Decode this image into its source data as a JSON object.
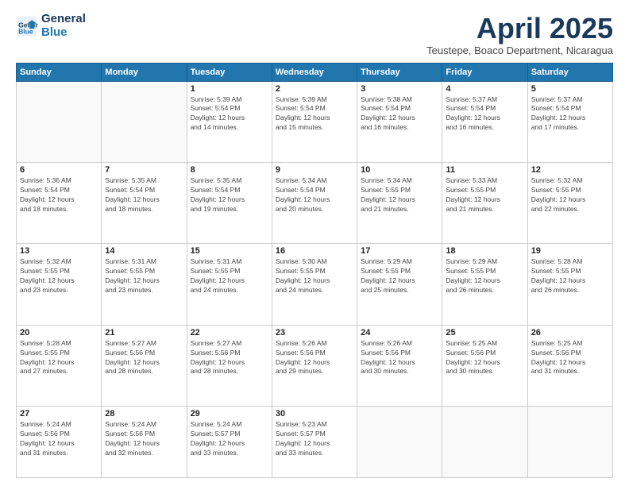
{
  "header": {
    "logo_line1": "General",
    "logo_line2": "Blue",
    "month": "April 2025",
    "location": "Teustepe, Boaco Department, Nicaragua"
  },
  "weekdays": [
    "Sunday",
    "Monday",
    "Tuesday",
    "Wednesday",
    "Thursday",
    "Friday",
    "Saturday"
  ],
  "weeks": [
    [
      {
        "day": "",
        "info": ""
      },
      {
        "day": "",
        "info": ""
      },
      {
        "day": "1",
        "info": "Sunrise: 5:39 AM\nSunset: 5:54 PM\nDaylight: 12 hours\nand 14 minutes."
      },
      {
        "day": "2",
        "info": "Sunrise: 5:39 AM\nSunset: 5:54 PM\nDaylight: 12 hours\nand 15 minutes."
      },
      {
        "day": "3",
        "info": "Sunrise: 5:38 AM\nSunset: 5:54 PM\nDaylight: 12 hours\nand 16 minutes."
      },
      {
        "day": "4",
        "info": "Sunrise: 5:37 AM\nSunset: 5:54 PM\nDaylight: 12 hours\nand 16 minutes."
      },
      {
        "day": "5",
        "info": "Sunrise: 5:37 AM\nSunset: 5:54 PM\nDaylight: 12 hours\nand 17 minutes."
      }
    ],
    [
      {
        "day": "6",
        "info": "Sunrise: 5:36 AM\nSunset: 5:54 PM\nDaylight: 12 hours\nand 18 minutes."
      },
      {
        "day": "7",
        "info": "Sunrise: 5:35 AM\nSunset: 5:54 PM\nDaylight: 12 hours\nand 18 minutes."
      },
      {
        "day": "8",
        "info": "Sunrise: 5:35 AM\nSunset: 5:54 PM\nDaylight: 12 hours\nand 19 minutes."
      },
      {
        "day": "9",
        "info": "Sunrise: 5:34 AM\nSunset: 5:54 PM\nDaylight: 12 hours\nand 20 minutes."
      },
      {
        "day": "10",
        "info": "Sunrise: 5:34 AM\nSunset: 5:55 PM\nDaylight: 12 hours\nand 21 minutes."
      },
      {
        "day": "11",
        "info": "Sunrise: 5:33 AM\nSunset: 5:55 PM\nDaylight: 12 hours\nand 21 minutes."
      },
      {
        "day": "12",
        "info": "Sunrise: 5:32 AM\nSunset: 5:55 PM\nDaylight: 12 hours\nand 22 minutes."
      }
    ],
    [
      {
        "day": "13",
        "info": "Sunrise: 5:32 AM\nSunset: 5:55 PM\nDaylight: 12 hours\nand 23 minutes."
      },
      {
        "day": "14",
        "info": "Sunrise: 5:31 AM\nSunset: 5:55 PM\nDaylight: 12 hours\nand 23 minutes."
      },
      {
        "day": "15",
        "info": "Sunrise: 5:31 AM\nSunset: 5:55 PM\nDaylight: 12 hours\nand 24 minutes."
      },
      {
        "day": "16",
        "info": "Sunrise: 5:30 AM\nSunset: 5:55 PM\nDaylight: 12 hours\nand 24 minutes."
      },
      {
        "day": "17",
        "info": "Sunrise: 5:29 AM\nSunset: 5:55 PM\nDaylight: 12 hours\nand 25 minutes."
      },
      {
        "day": "18",
        "info": "Sunrise: 5:29 AM\nSunset: 5:55 PM\nDaylight: 12 hours\nand 26 minutes."
      },
      {
        "day": "19",
        "info": "Sunrise: 5:28 AM\nSunset: 5:55 PM\nDaylight: 12 hours\nand 26 minutes."
      }
    ],
    [
      {
        "day": "20",
        "info": "Sunrise: 5:28 AM\nSunset: 5:55 PM\nDaylight: 12 hours\nand 27 minutes."
      },
      {
        "day": "21",
        "info": "Sunrise: 5:27 AM\nSunset: 5:56 PM\nDaylight: 12 hours\nand 28 minutes."
      },
      {
        "day": "22",
        "info": "Sunrise: 5:27 AM\nSunset: 5:56 PM\nDaylight: 12 hours\nand 28 minutes."
      },
      {
        "day": "23",
        "info": "Sunrise: 5:26 AM\nSunset: 5:56 PM\nDaylight: 12 hours\nand 29 minutes."
      },
      {
        "day": "24",
        "info": "Sunrise: 5:26 AM\nSunset: 5:56 PM\nDaylight: 12 hours\nand 30 minutes."
      },
      {
        "day": "25",
        "info": "Sunrise: 5:25 AM\nSunset: 5:56 PM\nDaylight: 12 hours\nand 30 minutes."
      },
      {
        "day": "26",
        "info": "Sunrise: 5:25 AM\nSunset: 5:56 PM\nDaylight: 12 hours\nand 31 minutes."
      }
    ],
    [
      {
        "day": "27",
        "info": "Sunrise: 5:24 AM\nSunset: 5:56 PM\nDaylight: 12 hours\nand 31 minutes."
      },
      {
        "day": "28",
        "info": "Sunrise: 5:24 AM\nSunset: 5:56 PM\nDaylight: 12 hours\nand 32 minutes."
      },
      {
        "day": "29",
        "info": "Sunrise: 5:24 AM\nSunset: 5:57 PM\nDaylight: 12 hours\nand 33 minutes."
      },
      {
        "day": "30",
        "info": "Sunrise: 5:23 AM\nSunset: 5:57 PM\nDaylight: 12 hours\nand 33 minutes."
      },
      {
        "day": "",
        "info": ""
      },
      {
        "day": "",
        "info": ""
      },
      {
        "day": "",
        "info": ""
      }
    ]
  ]
}
